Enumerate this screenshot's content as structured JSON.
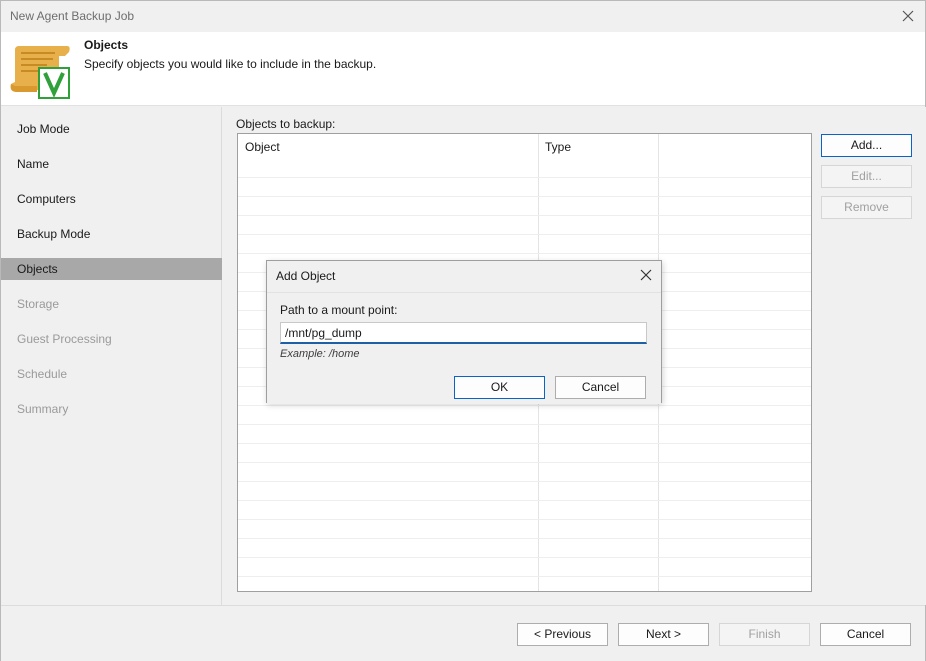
{
  "window": {
    "title": "New Agent Backup Job"
  },
  "header": {
    "title": "Objects",
    "description": "Specify objects you would like to include in the backup."
  },
  "sidebar": {
    "steps": [
      {
        "label": "Job Mode",
        "state": "normal"
      },
      {
        "label": "Name",
        "state": "normal"
      },
      {
        "label": "Computers",
        "state": "normal"
      },
      {
        "label": "Backup Mode",
        "state": "normal"
      },
      {
        "label": "Objects",
        "state": "active"
      },
      {
        "label": "Storage",
        "state": "disabled"
      },
      {
        "label": "Guest Processing",
        "state": "disabled"
      },
      {
        "label": "Schedule",
        "state": "disabled"
      },
      {
        "label": "Summary",
        "state": "disabled"
      }
    ]
  },
  "main": {
    "objects_label": "Objects to backup:",
    "columns": [
      "Object",
      "Type"
    ],
    "rows": []
  },
  "side_buttons": {
    "add": "Add...",
    "edit": "Edit...",
    "remove": "Remove"
  },
  "footer": {
    "previous": "< Previous",
    "next": "Next >",
    "finish": "Finish",
    "cancel": "Cancel"
  },
  "dialog": {
    "title": "Add Object",
    "label": "Path to a mount point:",
    "input_value": "/mnt/pg_dump",
    "example": "Example: /home",
    "ok": "OK",
    "cancel": "Cancel"
  },
  "colors": {
    "accent": "#0a64c8",
    "active_step_bg": "#a8a8a8",
    "logo_green": "#2fa03a",
    "logo_gold": "#e8b04a"
  },
  "icons": {
    "close": "close-icon",
    "header": "veeam-scroll-v-icon"
  }
}
